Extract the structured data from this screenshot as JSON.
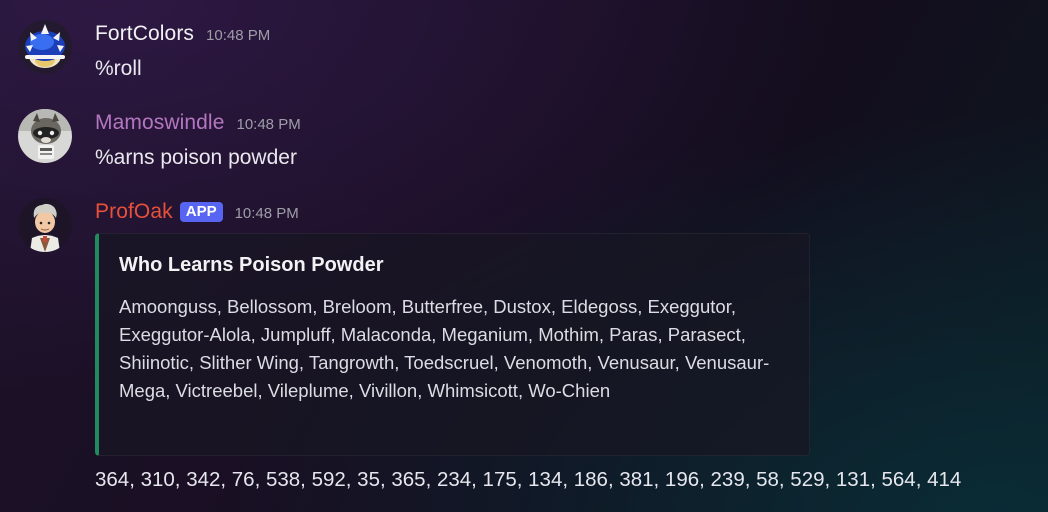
{
  "messages": [
    {
      "username": "FortColors",
      "username_color": "#f2f2f5",
      "timestamp": "10:48 PM",
      "content": "%roll",
      "avatar_icon": "blue-shell-icon"
    },
    {
      "username": "Mamoswindle",
      "username_color": "#b377c0",
      "timestamp": "10:48 PM",
      "content": "%arns poison powder",
      "avatar_icon": "raccoon-avatar-icon"
    },
    {
      "username": "ProfOak",
      "username_color": "#e8503a",
      "badge": "APP",
      "timestamp": "10:48 PM",
      "avatar_icon": "prof-oak-avatar-icon",
      "embed": {
        "accent_color": "#1f8b5e",
        "title": "Who Learns Poison Powder",
        "description": "Amoonguss, Bellossom, Breloom, Butterfree, Dustox, Eldegoss, Exeggutor, Exeggutor-Alola, Jumpluff, Malaconda, Meganium, Mothim, Paras, Parasect, Shiinotic, Slither Wing, Tangrowth, Toedscruel, Venomoth, Venusaur, Venusaur-Mega, Victreebel, Vileplume, Vivillon, Whimsicott, Wo-Chien"
      },
      "followup": "364, 310, 342, 76, 538, 592, 35, 365, 234, 175, 134, 186, 381, 196, 239, 58, 529, 131, 564, 414"
    }
  ]
}
